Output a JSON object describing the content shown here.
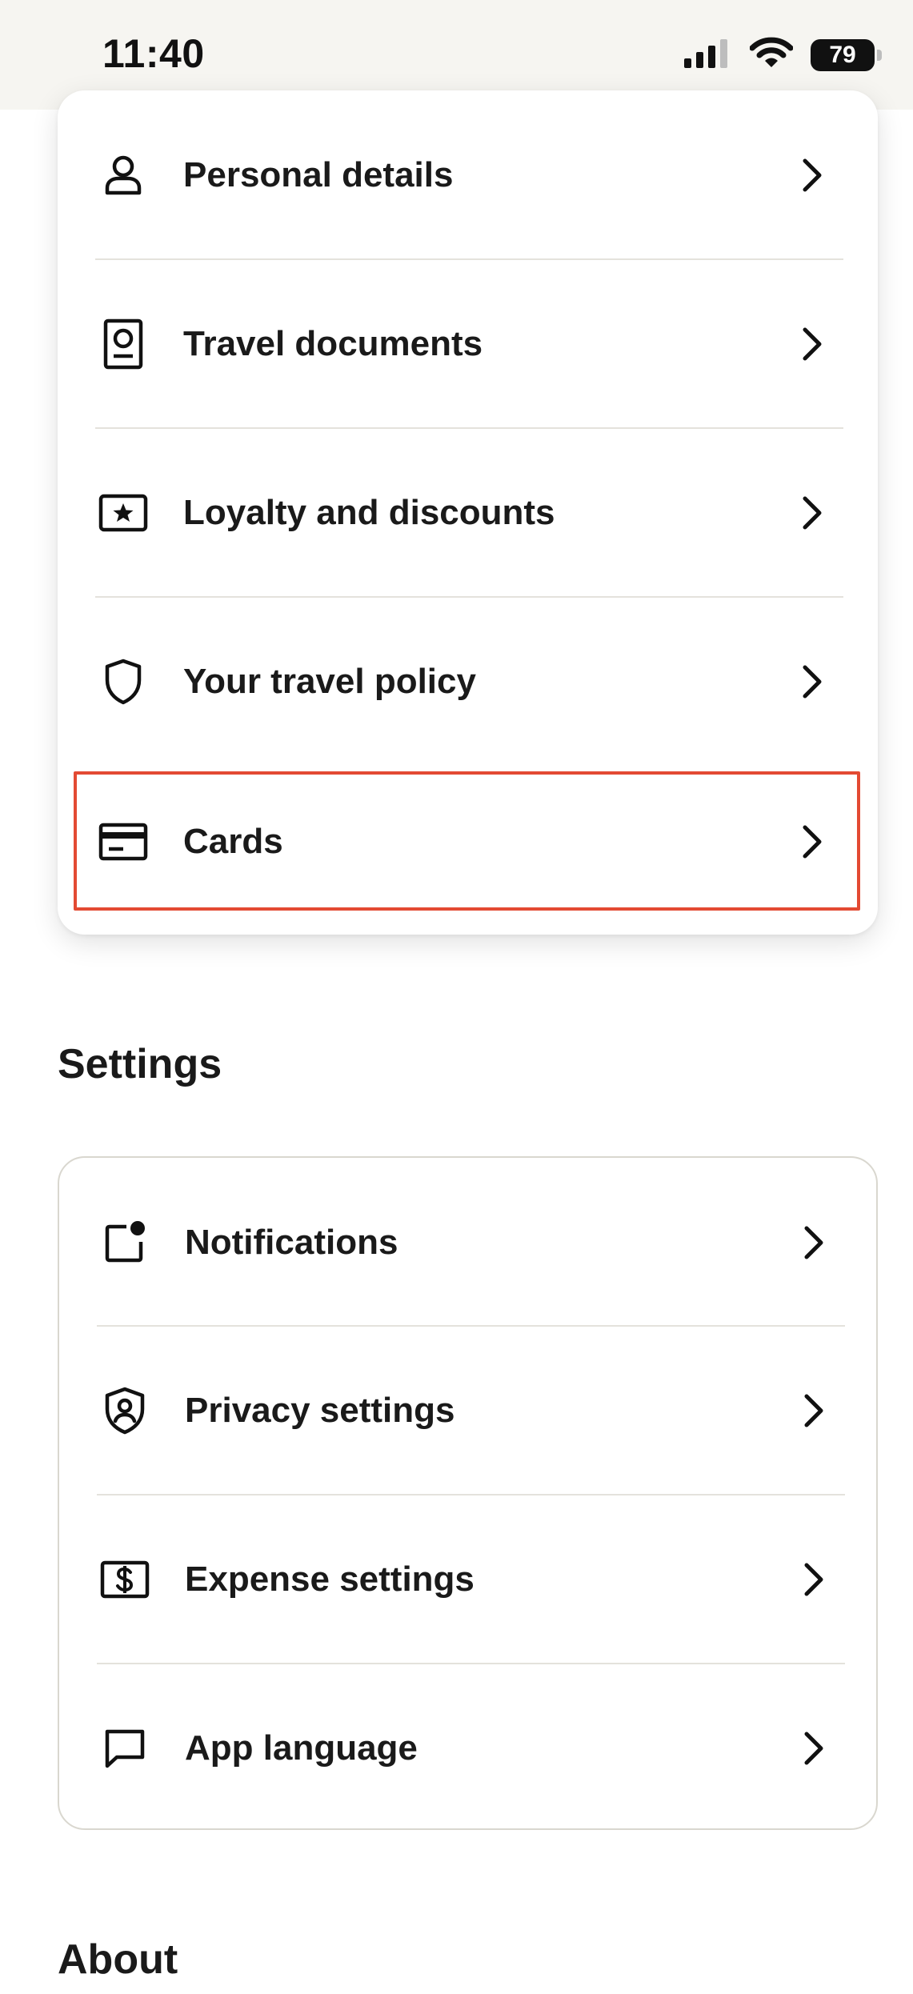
{
  "status_bar": {
    "time": "11:40",
    "battery": "79"
  },
  "account_card": {
    "items": [
      {
        "label": "Personal details",
        "icon": "person-icon"
      },
      {
        "label": "Travel documents",
        "icon": "passport-icon"
      },
      {
        "label": "Loyalty and discounts",
        "icon": "star-ticket-icon"
      },
      {
        "label": "Your travel policy",
        "icon": "shield-icon"
      },
      {
        "label": "Cards",
        "icon": "credit-card-icon",
        "highlighted": true
      }
    ]
  },
  "settings": {
    "title": "Settings",
    "items": [
      {
        "label": "Notifications",
        "icon": "notification-icon"
      },
      {
        "label": "Privacy settings",
        "icon": "privacy-shield-icon"
      },
      {
        "label": "Expense settings",
        "icon": "dollar-icon"
      },
      {
        "label": "App language",
        "icon": "chat-bubble-icon"
      }
    ]
  },
  "about": {
    "title": "About"
  },
  "colors": {
    "highlight": "#e34a33",
    "status_bg": "#f6f5f1",
    "divider": "#e4e2dc"
  }
}
